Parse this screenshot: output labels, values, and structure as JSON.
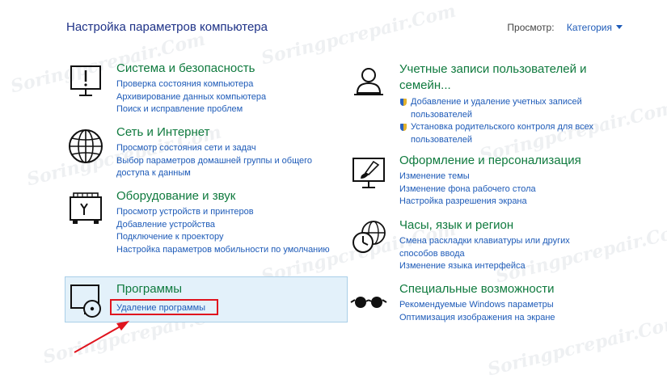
{
  "header": {
    "title": "Настройка параметров компьютера",
    "view_label": "Просмотр:",
    "view_value": "Категория"
  },
  "watermark": "Soringpcrepair.Com",
  "categories": [
    {
      "title": "Система и безопасность",
      "icon": "monitor-exclamation-icon",
      "links": [
        "Проверка состояния компьютера",
        "Архивирование данных компьютера",
        "Поиск и исправление проблем"
      ]
    },
    {
      "title": "Сеть и Интернет",
      "icon": "globe-icon",
      "links": [
        "Просмотр состояния сети и задач",
        "Выбор параметров домашней группы и общего доступа к данным"
      ]
    },
    {
      "title": "Оборудование и звук",
      "icon": "hardware-sound-icon",
      "links": [
        "Просмотр устройств и принтеров",
        "Добавление устройства",
        "Подключение к проектору",
        "Настройка параметров мобильности по умолчанию"
      ]
    },
    {
      "title": "Программы",
      "icon": "programs-disc-icon",
      "links": [
        "Удаление программы"
      ]
    },
    {
      "title": "Учетные записи пользователей и семейн...",
      "icon": "user-accounts-icon",
      "links": [
        "Добавление и удаление учетных записей пользователей",
        "Установка родительского контроля для всех пользователей"
      ]
    },
    {
      "title": "Оформление и персонализация",
      "icon": "personalization-brush-icon",
      "links": [
        "Изменение темы",
        "Изменение фона рабочего стола",
        "Настройка разрешения экрана"
      ]
    },
    {
      "title": "Часы, язык и регион",
      "icon": "clock-globe-icon",
      "links": [
        "Смена раскладки клавиатуры или других способов ввода",
        "Изменение языка интерфейса"
      ]
    },
    {
      "title": "Специальные возможности",
      "icon": "accessibility-glasses-icon",
      "links": [
        "Рекомендуемые Windows параметры",
        "Оптимизация изображения на экране"
      ]
    }
  ],
  "colors": {
    "category_title": "#0f7a3e",
    "link": "#1e5bb8",
    "highlight_bg": "#e3f1fa",
    "annotation_red": "#e0141e"
  }
}
